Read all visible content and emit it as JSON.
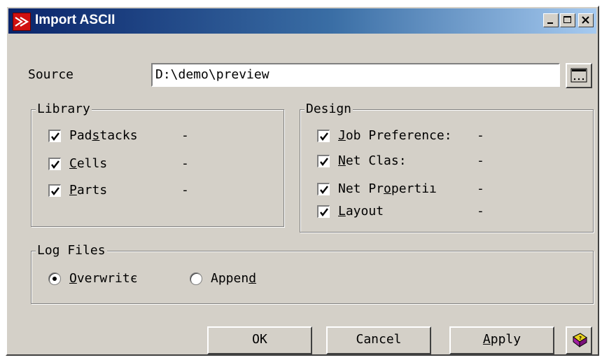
{
  "window": {
    "title": "Import ASCII",
    "icon": "app-logo-icon",
    "controls": [
      "minimize-icon",
      "maximize-icon",
      "close-icon"
    ]
  },
  "source": {
    "label": "Source",
    "value": "D:\\demo\\preview",
    "browse_icon": "browse-icon"
  },
  "library": {
    "title": "Library",
    "items": [
      {
        "pre": "Pad",
        "u": "s",
        "post": "tacks",
        "checked": true,
        "status": "-"
      },
      {
        "pre": "",
        "u": "C",
        "post": "ells",
        "checked": true,
        "status": "-"
      },
      {
        "pre": "",
        "u": "P",
        "post": "arts",
        "checked": true,
        "status": "-"
      }
    ]
  },
  "design": {
    "title": "Design",
    "items": [
      {
        "pre": "",
        "u": "J",
        "post": "ob Preference:",
        "checked": true,
        "status": "-"
      },
      {
        "pre": "",
        "u": "N",
        "post": "et Clas:",
        "checked": true,
        "status": "-"
      },
      {
        "pre": "Net Pr",
        "u": "o",
        "post": "pertiı",
        "checked": true,
        "status": "-"
      },
      {
        "pre": "",
        "u": "L",
        "post": "ayout",
        "checked": true,
        "status": "-"
      }
    ]
  },
  "log_files": {
    "title": "Log Files",
    "overwrite": {
      "pre": "",
      "u": "O",
      "post": "verwritє",
      "selected": true
    },
    "append": {
      "pre": "Appen",
      "u": "d",
      "post": "",
      "selected": false
    }
  },
  "buttons": {
    "ok": "OK",
    "cancel": "Cancel",
    "apply_u": "A",
    "apply_post": "pply",
    "help_icon": "help-book-icon"
  },
  "colors": {
    "title_start": "#0a246a",
    "title_end": "#a6caf0",
    "face": "#d4d0c8"
  }
}
